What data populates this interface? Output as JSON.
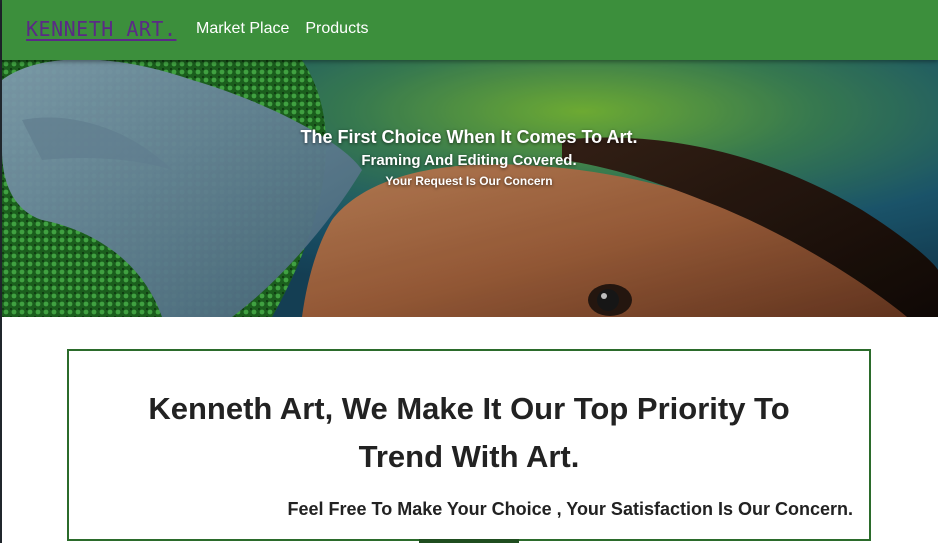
{
  "navbar": {
    "brand": "KENNETH ART.",
    "links": [
      "Market Place",
      "Products"
    ]
  },
  "hero": {
    "title": "The First Choice When It Comes To Art.",
    "subtitle": "Framing And Editing Covered.",
    "tagline": "Your Request Is Our Concern"
  },
  "card": {
    "heading": "Kenneth Art, We Make It Our Top Priority To Trend With Art.",
    "text": "Feel Free To Make Your Choice , Your Satisfaction Is Our Concern."
  },
  "colors": {
    "navbar": "#3c8f3c",
    "brand": "#5b2a86",
    "card_border": "#2b6b2b"
  }
}
